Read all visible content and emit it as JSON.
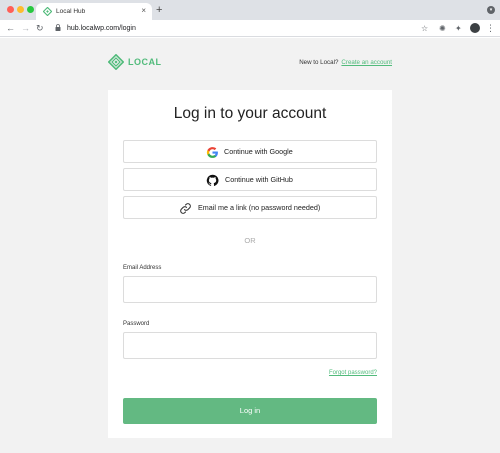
{
  "browser": {
    "tab_title": "Local Hub",
    "tab_close": "×",
    "new_tab": "+",
    "url": "hub.localwp.com/login",
    "back": "←",
    "forward": "→",
    "reload": "↻",
    "star": "☆",
    "menu": "⋮"
  },
  "header": {
    "logo_text": "LOCAL",
    "signup_prompt": "New to Local?",
    "signup_link": "Create an account"
  },
  "login": {
    "title": "Log in to your account",
    "google_label": "Continue with Google",
    "github_label": "Continue with GitHub",
    "email_link_label": "Email me a link (no password needed)",
    "divider": "OR",
    "email_label": "Email Address",
    "email_value": "",
    "password_label": "Password",
    "password_value": "",
    "forgot_link": "Forgot password?",
    "submit_label": "Log in"
  },
  "colors": {
    "brand": "#51bb7b",
    "button": "#63b982",
    "page_bg": "#f2f2f2"
  },
  "icons": [
    "local-logo-icon",
    "google-icon",
    "github-icon",
    "link-icon",
    "lock-icon",
    "star-icon",
    "profile-icon"
  ]
}
